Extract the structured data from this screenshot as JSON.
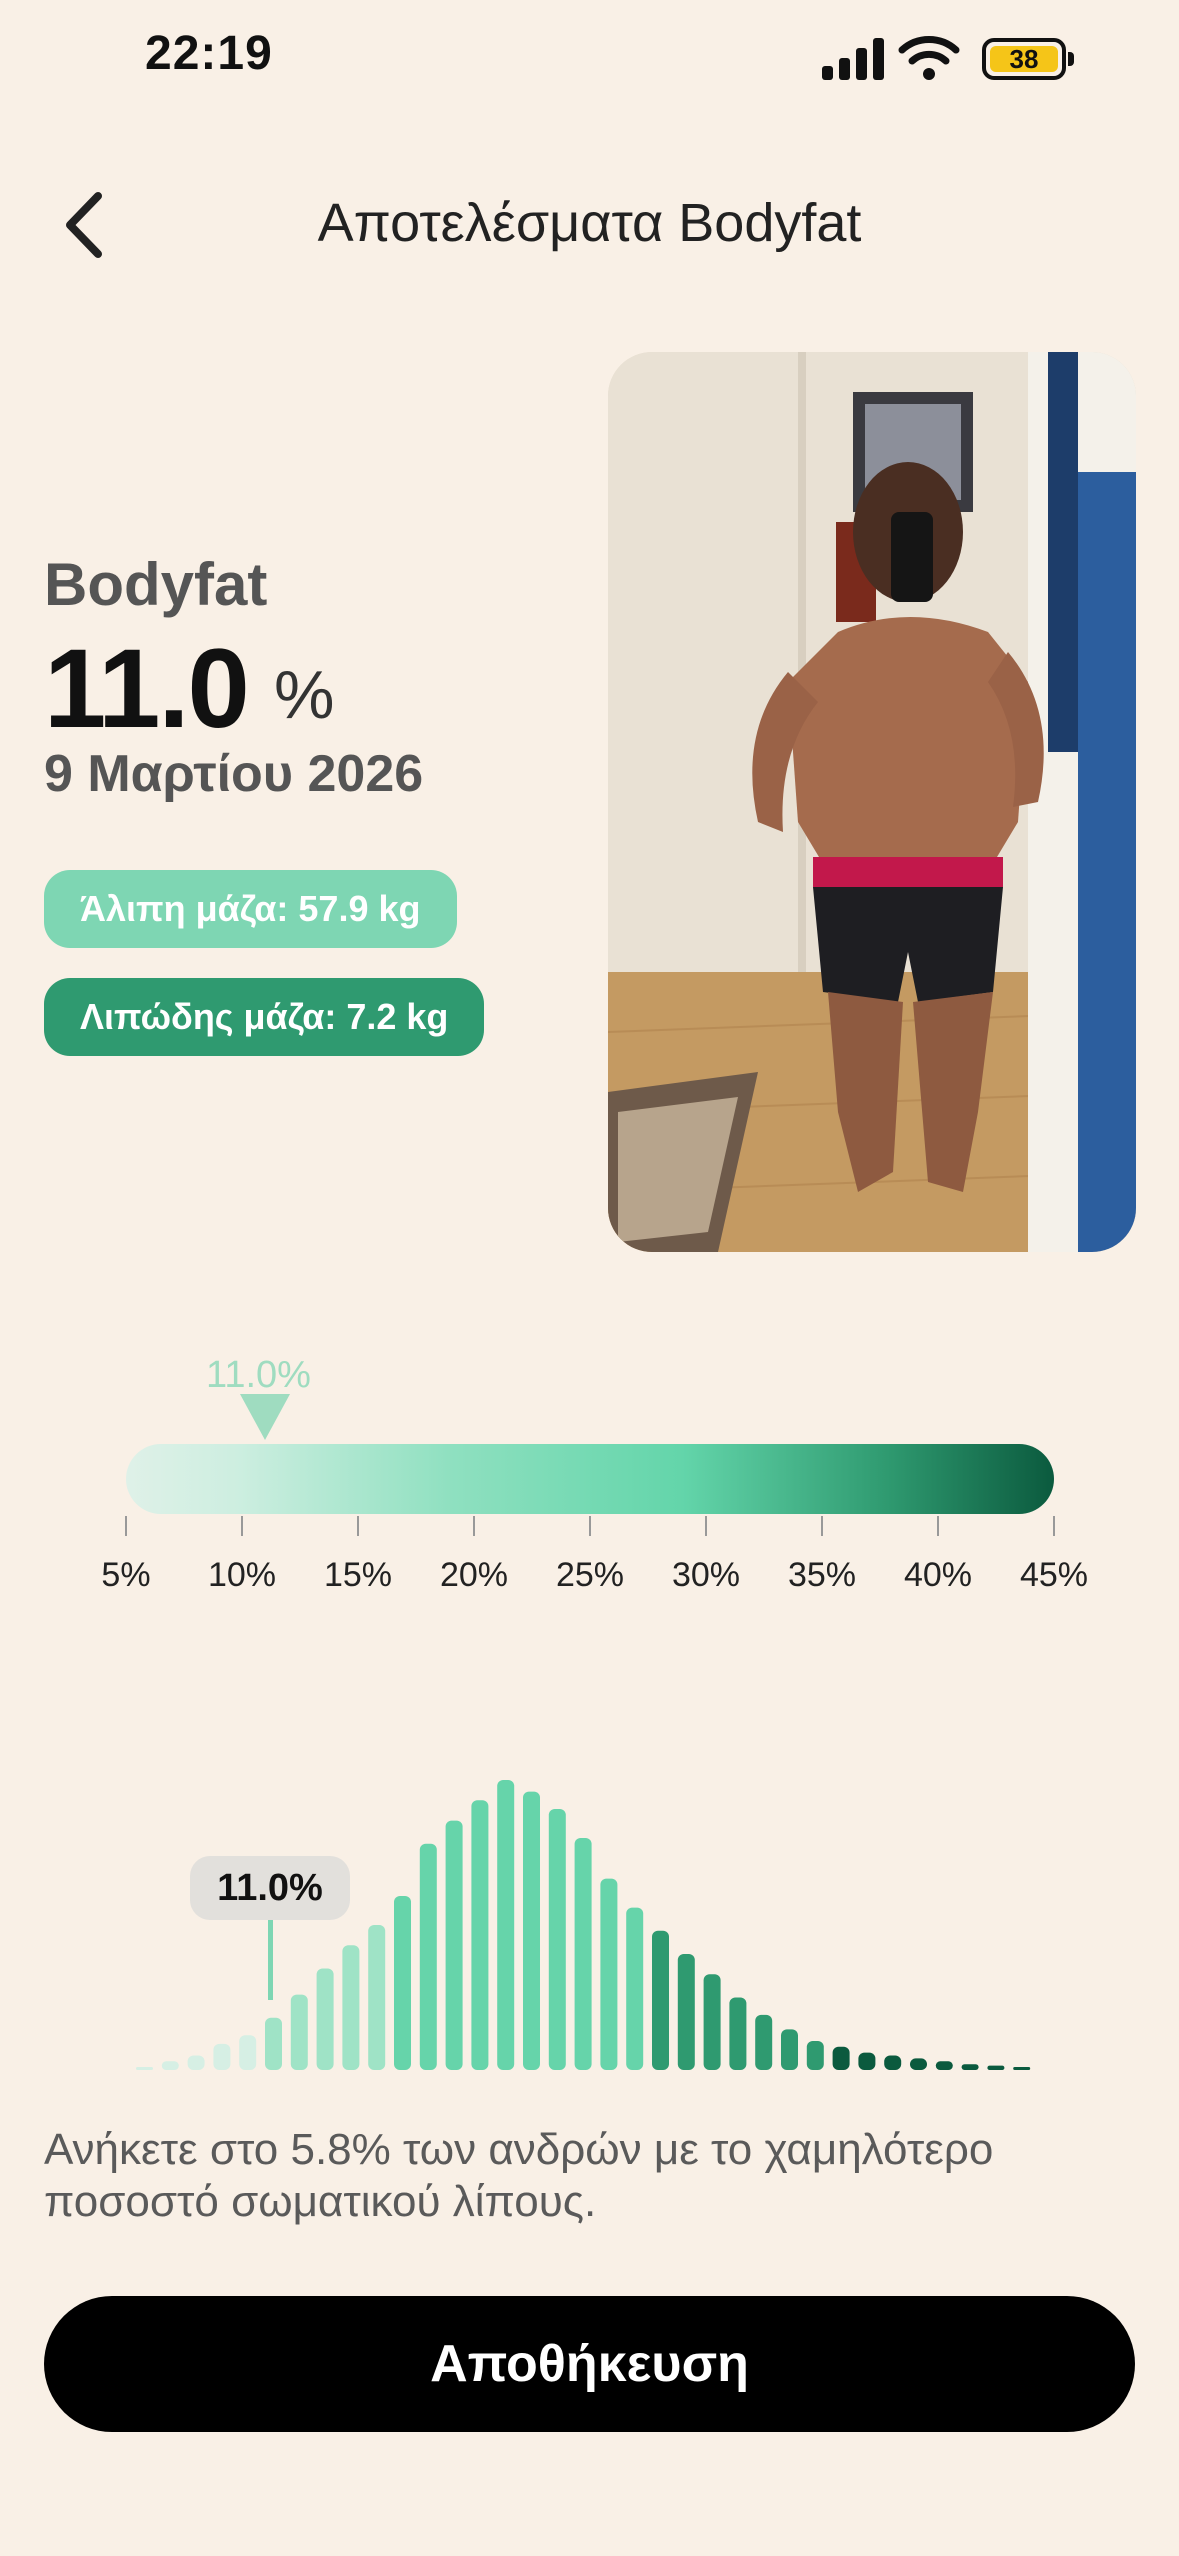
{
  "status_bar": {
    "time": "22:19",
    "battery": "38"
  },
  "header": {
    "title": "Αποτελέσματα Bodyfat"
  },
  "stats": {
    "label": "Bodyfat",
    "value": "11.0",
    "unit": "%",
    "date": "9 Μαρτίου 2026",
    "lean_mass": "Άλιπη μάζα: 57.9 kg",
    "fat_mass": "Λιπώδης μάζα: 7.2 kg"
  },
  "scale": {
    "marker": "11.0%",
    "marker_value": 11.0,
    "min": 5,
    "max": 45,
    "ticks": [
      "5%",
      "10%",
      "15%",
      "20%",
      "25%",
      "30%",
      "35%",
      "40%",
      "45%"
    ]
  },
  "distribution": {
    "tooltip": "11.0%",
    "highlight_index": 5,
    "bars": [
      1,
      3,
      5,
      9,
      12,
      18,
      26,
      35,
      43,
      50,
      60,
      78,
      86,
      93,
      100,
      96,
      90,
      80,
      66,
      56,
      48,
      40,
      33,
      25,
      19,
      14,
      10,
      8,
      6,
      5,
      4,
      3,
      2,
      1.5,
      1
    ]
  },
  "description": "Ανήκετε στο 5.8% των ανδρών με το χαμηλότερο ποσοστό σωματικού λίπους.",
  "actions": {
    "save_label": "Αποθήκευση"
  },
  "colors": {
    "background": "#f9f0e6",
    "light_green": "#7ed6b3",
    "dark_green": "#2f9a70",
    "deep_green": "#0b5a3e"
  }
}
